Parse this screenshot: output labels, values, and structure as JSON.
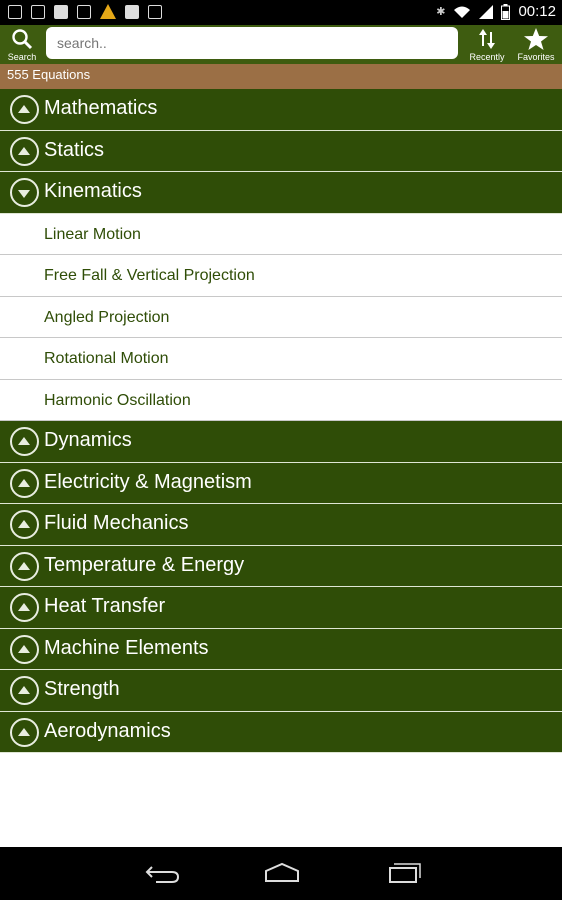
{
  "status_bar": {
    "time": "00:12"
  },
  "toolbar": {
    "search_label": "Search",
    "search_placeholder": "search..",
    "recently_label": "Recently",
    "favorites_label": "Favorites"
  },
  "equation_count": "555 Equations",
  "categories": [
    {
      "name": "Mathematics",
      "expanded": false
    },
    {
      "name": "Statics",
      "expanded": false
    },
    {
      "name": "Kinematics",
      "expanded": true,
      "items": [
        "Linear Motion",
        "Free Fall & Vertical Projection",
        "Angled Projection",
        "Rotational Motion",
        "Harmonic Oscillation"
      ]
    },
    {
      "name": "Dynamics",
      "expanded": false
    },
    {
      "name": "Electricity & Magnetism",
      "expanded": false
    },
    {
      "name": "Fluid Mechanics",
      "expanded": false
    },
    {
      "name": "Temperature & Energy",
      "expanded": false
    },
    {
      "name": "Heat Transfer",
      "expanded": false
    },
    {
      "name": "Machine Elements",
      "expanded": false
    },
    {
      "name": "Strength",
      "expanded": false
    },
    {
      "name": "Aerodynamics",
      "expanded": false
    }
  ],
  "colors": {
    "toolbar": "#3e5c10",
    "category_bg": "#2f4d07",
    "count_bar": "#9b6f45",
    "sub_text": "#2f4d07"
  }
}
